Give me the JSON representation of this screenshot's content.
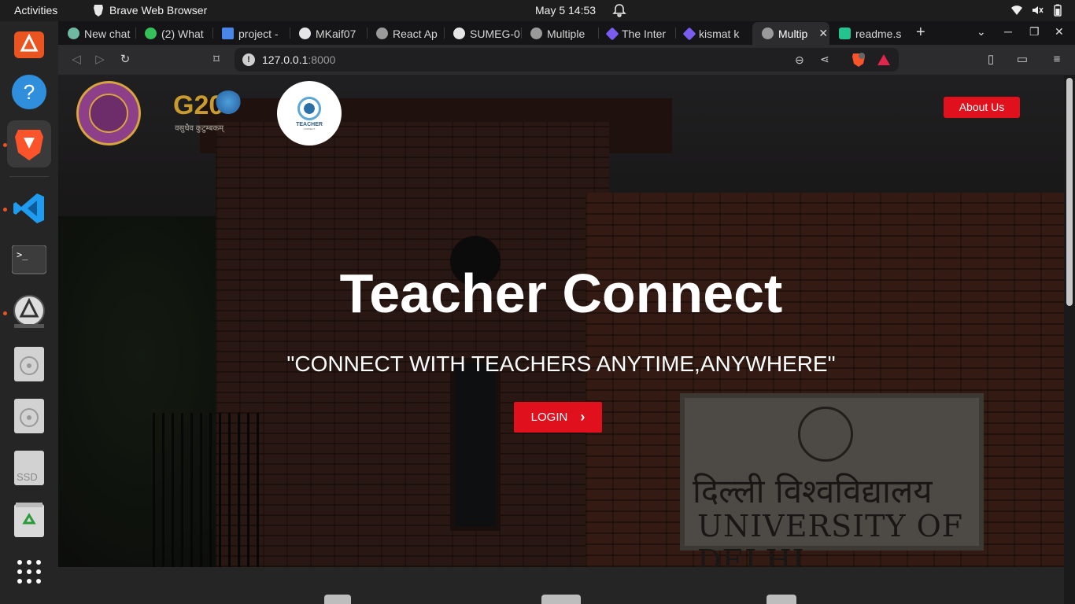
{
  "topbar": {
    "activities": "Activities",
    "app_name": "Brave Web Browser",
    "clock": "May 5  14:53"
  },
  "dock": {
    "items": [
      "ubuntu-software",
      "help",
      "brave-browser",
      "vscode",
      "terminal",
      "software-updater",
      "optical-drive-1",
      "optical-drive-2",
      "ssd-drive",
      "trash",
      "show-applications"
    ],
    "ssd_label": "SSD"
  },
  "tabs": [
    {
      "label": "New chat"
    },
    {
      "label": "(2) What"
    },
    {
      "label": "project -"
    },
    {
      "label": "MKaif07"
    },
    {
      "label": "React Ap"
    },
    {
      "label": "SUMEG-0"
    },
    {
      "label": "Multiple"
    },
    {
      "label": "The Inter"
    },
    {
      "label": "kismat k"
    },
    {
      "label": "Multip",
      "active": true
    },
    {
      "label": "readme.s"
    }
  ],
  "toolbar": {
    "url_host": "127.0.0.1",
    "url_port": ":8000",
    "shield_count": "1"
  },
  "page": {
    "about_button": "About Us",
    "title": "Teacher Connect",
    "tagline": "\"CONNECT WITH TEACHERS ANYTIME,ANYWHERE\"",
    "login_button": "LOGIN",
    "logo_tc_label": "TEACHER",
    "logo_tc_sublabel": "CONNECT",
    "g20_text": "G20",
    "g20_sub": "वसुधैव कुटुम्बकम्",
    "sign_hindi": "दिल्ली विश्वविद्यालय",
    "sign_english": "UNIVERSITY OF DELHI"
  },
  "colors": {
    "accent_red": "#e0101c",
    "dock_dot": "#e95420"
  }
}
